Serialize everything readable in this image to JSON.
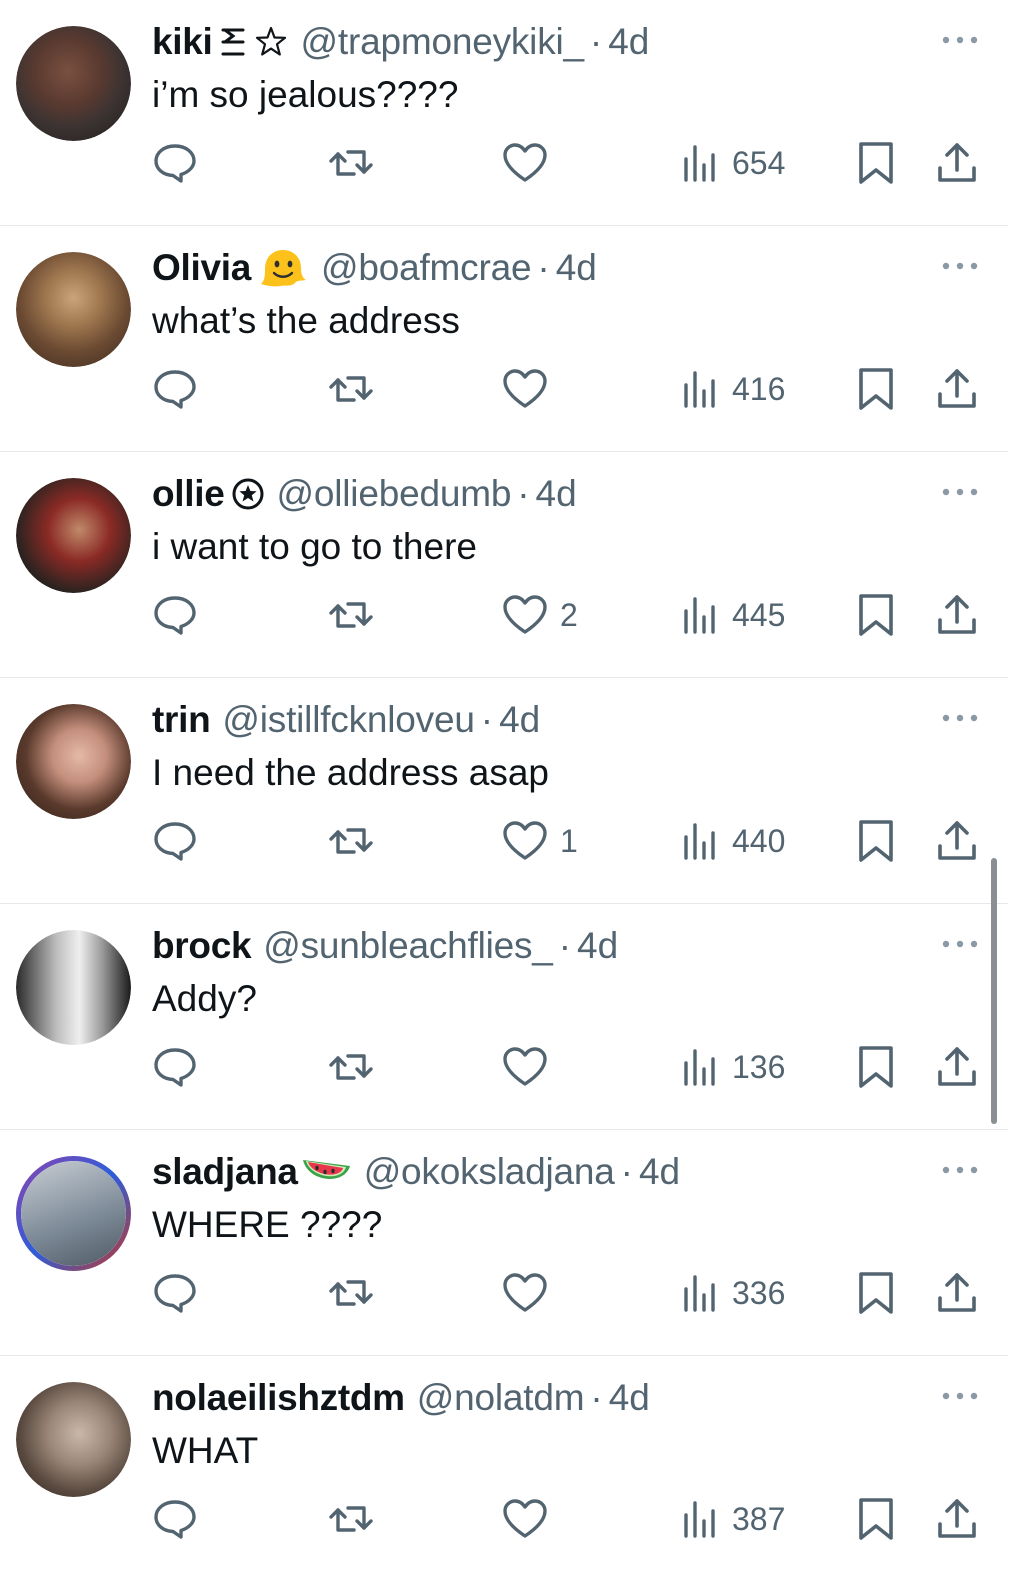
{
  "tweets": [
    {
      "name": "kiki",
      "badge": "kiki-glyphs",
      "handle": "@trapmoneykiki_",
      "time": "4d",
      "text": "i’m so jealous????",
      "likes": "",
      "views": "654",
      "avatar_colors": [
        "#3b3332",
        "#7a5040"
      ]
    },
    {
      "name": "Olivia",
      "badge": "melting-face-emoji",
      "handle": "@boafmcrae",
      "time": "4d",
      "text": "what’s the address",
      "likes": "",
      "views": "416",
      "avatar_colors": [
        "#6b4a32",
        "#caa47a"
      ]
    },
    {
      "name": "ollie",
      "badge": "star-badge",
      "handle": "@olliebedumb",
      "time": "4d",
      "text": "i want to go to there",
      "likes": "2",
      "views": "445",
      "avatar_colors": [
        "#2b2320",
        "#8b2a25"
      ]
    },
    {
      "name": "trin",
      "badge": "",
      "handle": "@istillfcknloveu",
      "time": "4d",
      "text": "I need the address asap",
      "likes": "1",
      "views": "440",
      "avatar_colors": [
        "#2a1d17",
        "#e5b9a8"
      ]
    },
    {
      "name": "brock",
      "badge": "",
      "handle": "@sunbleachflies_",
      "time": "4d",
      "text": "Addy?",
      "likes": "",
      "views": "136",
      "avatar_colors": [
        "#1a1a1a",
        "#d9d9d9"
      ]
    },
    {
      "name": "sladjana",
      "badge": "watermelon-emoji",
      "handle": "@okoksladjana",
      "time": "4d",
      "text": "WHERE ????",
      "likes": "",
      "views": "336",
      "avatar_colors": [
        "#7a8794",
        "#c9ced4"
      ]
    },
    {
      "name": "nolaeilishztdm",
      "badge": "",
      "handle": "@nolatdm",
      "time": "4d",
      "text": "WHAT",
      "likes": "",
      "views": "387",
      "avatar_colors": [
        "#5a4a40",
        "#c9b8aa"
      ]
    }
  ],
  "icons": {
    "reply": "reply-icon",
    "retweet": "retweet-icon",
    "like": "like-icon",
    "views": "views-icon",
    "bookmark": "bookmark-icon",
    "share": "share-icon",
    "more": "more-icon"
  },
  "colors": {
    "text": "#0f1419",
    "secondary": "#536471",
    "divider": "#e6e9ec"
  }
}
